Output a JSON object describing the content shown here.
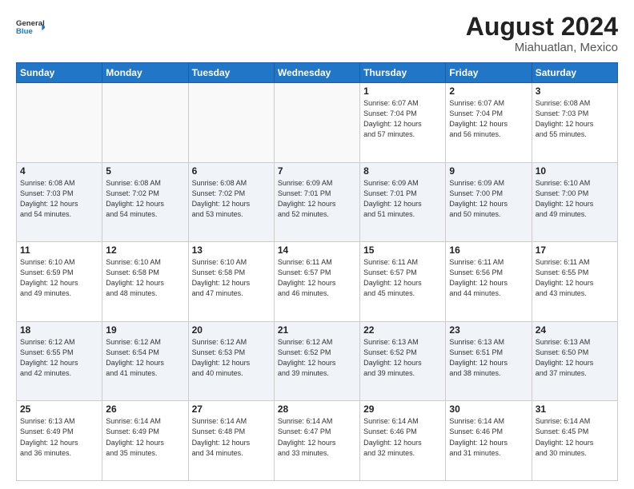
{
  "header": {
    "logo_line1": "General",
    "logo_line2": "Blue",
    "title": "August 2024",
    "location": "Miahuatlan, Mexico"
  },
  "days_of_week": [
    "Sunday",
    "Monday",
    "Tuesday",
    "Wednesday",
    "Thursday",
    "Friday",
    "Saturday"
  ],
  "weeks": [
    [
      {
        "day": "",
        "info": ""
      },
      {
        "day": "",
        "info": ""
      },
      {
        "day": "",
        "info": ""
      },
      {
        "day": "",
        "info": ""
      },
      {
        "day": "1",
        "info": "Sunrise: 6:07 AM\nSunset: 7:04 PM\nDaylight: 12 hours\nand 57 minutes."
      },
      {
        "day": "2",
        "info": "Sunrise: 6:07 AM\nSunset: 7:04 PM\nDaylight: 12 hours\nand 56 minutes."
      },
      {
        "day": "3",
        "info": "Sunrise: 6:08 AM\nSunset: 7:03 PM\nDaylight: 12 hours\nand 55 minutes."
      }
    ],
    [
      {
        "day": "4",
        "info": "Sunrise: 6:08 AM\nSunset: 7:03 PM\nDaylight: 12 hours\nand 54 minutes."
      },
      {
        "day": "5",
        "info": "Sunrise: 6:08 AM\nSunset: 7:02 PM\nDaylight: 12 hours\nand 54 minutes."
      },
      {
        "day": "6",
        "info": "Sunrise: 6:08 AM\nSunset: 7:02 PM\nDaylight: 12 hours\nand 53 minutes."
      },
      {
        "day": "7",
        "info": "Sunrise: 6:09 AM\nSunset: 7:01 PM\nDaylight: 12 hours\nand 52 minutes."
      },
      {
        "day": "8",
        "info": "Sunrise: 6:09 AM\nSunset: 7:01 PM\nDaylight: 12 hours\nand 51 minutes."
      },
      {
        "day": "9",
        "info": "Sunrise: 6:09 AM\nSunset: 7:00 PM\nDaylight: 12 hours\nand 50 minutes."
      },
      {
        "day": "10",
        "info": "Sunrise: 6:10 AM\nSunset: 7:00 PM\nDaylight: 12 hours\nand 49 minutes."
      }
    ],
    [
      {
        "day": "11",
        "info": "Sunrise: 6:10 AM\nSunset: 6:59 PM\nDaylight: 12 hours\nand 49 minutes."
      },
      {
        "day": "12",
        "info": "Sunrise: 6:10 AM\nSunset: 6:58 PM\nDaylight: 12 hours\nand 48 minutes."
      },
      {
        "day": "13",
        "info": "Sunrise: 6:10 AM\nSunset: 6:58 PM\nDaylight: 12 hours\nand 47 minutes."
      },
      {
        "day": "14",
        "info": "Sunrise: 6:11 AM\nSunset: 6:57 PM\nDaylight: 12 hours\nand 46 minutes."
      },
      {
        "day": "15",
        "info": "Sunrise: 6:11 AM\nSunset: 6:57 PM\nDaylight: 12 hours\nand 45 minutes."
      },
      {
        "day": "16",
        "info": "Sunrise: 6:11 AM\nSunset: 6:56 PM\nDaylight: 12 hours\nand 44 minutes."
      },
      {
        "day": "17",
        "info": "Sunrise: 6:11 AM\nSunset: 6:55 PM\nDaylight: 12 hours\nand 43 minutes."
      }
    ],
    [
      {
        "day": "18",
        "info": "Sunrise: 6:12 AM\nSunset: 6:55 PM\nDaylight: 12 hours\nand 42 minutes."
      },
      {
        "day": "19",
        "info": "Sunrise: 6:12 AM\nSunset: 6:54 PM\nDaylight: 12 hours\nand 41 minutes."
      },
      {
        "day": "20",
        "info": "Sunrise: 6:12 AM\nSunset: 6:53 PM\nDaylight: 12 hours\nand 40 minutes."
      },
      {
        "day": "21",
        "info": "Sunrise: 6:12 AM\nSunset: 6:52 PM\nDaylight: 12 hours\nand 39 minutes."
      },
      {
        "day": "22",
        "info": "Sunrise: 6:13 AM\nSunset: 6:52 PM\nDaylight: 12 hours\nand 39 minutes."
      },
      {
        "day": "23",
        "info": "Sunrise: 6:13 AM\nSunset: 6:51 PM\nDaylight: 12 hours\nand 38 minutes."
      },
      {
        "day": "24",
        "info": "Sunrise: 6:13 AM\nSunset: 6:50 PM\nDaylight: 12 hours\nand 37 minutes."
      }
    ],
    [
      {
        "day": "25",
        "info": "Sunrise: 6:13 AM\nSunset: 6:49 PM\nDaylight: 12 hours\nand 36 minutes."
      },
      {
        "day": "26",
        "info": "Sunrise: 6:14 AM\nSunset: 6:49 PM\nDaylight: 12 hours\nand 35 minutes."
      },
      {
        "day": "27",
        "info": "Sunrise: 6:14 AM\nSunset: 6:48 PM\nDaylight: 12 hours\nand 34 minutes."
      },
      {
        "day": "28",
        "info": "Sunrise: 6:14 AM\nSunset: 6:47 PM\nDaylight: 12 hours\nand 33 minutes."
      },
      {
        "day": "29",
        "info": "Sunrise: 6:14 AM\nSunset: 6:46 PM\nDaylight: 12 hours\nand 32 minutes."
      },
      {
        "day": "30",
        "info": "Sunrise: 6:14 AM\nSunset: 6:46 PM\nDaylight: 12 hours\nand 31 minutes."
      },
      {
        "day": "31",
        "info": "Sunrise: 6:14 AM\nSunset: 6:45 PM\nDaylight: 12 hours\nand 30 minutes."
      }
    ]
  ]
}
